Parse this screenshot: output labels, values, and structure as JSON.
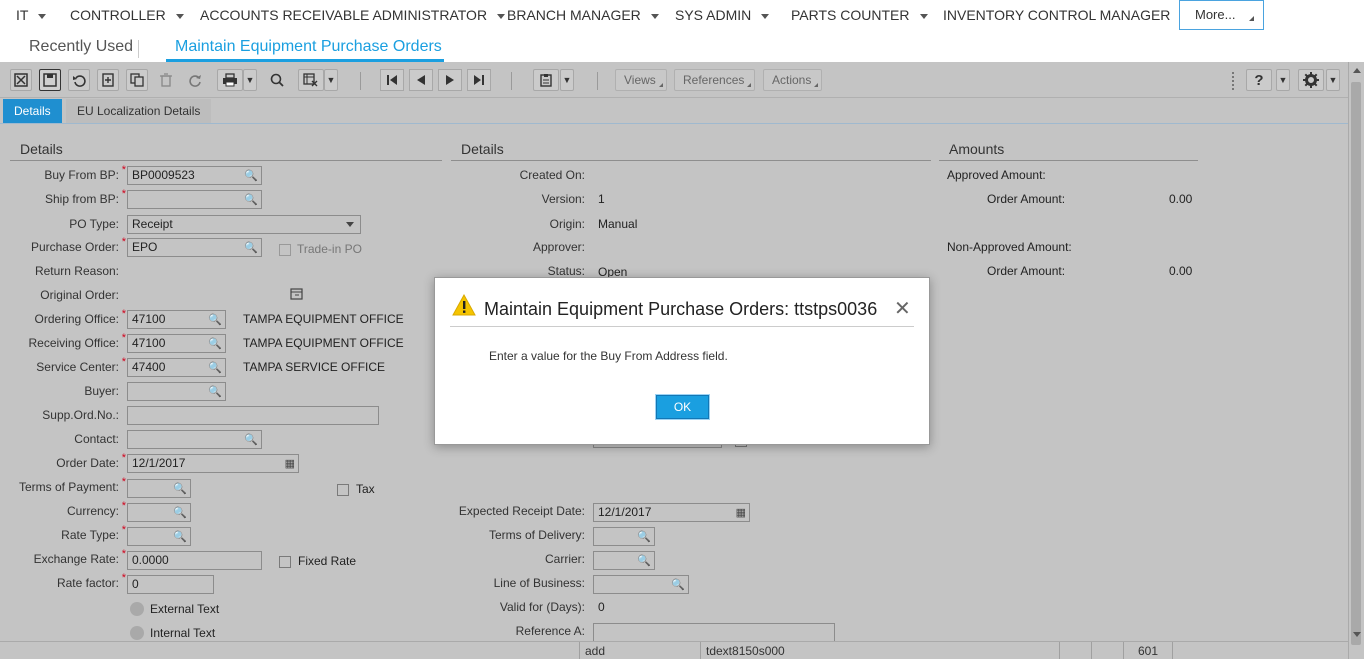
{
  "menu": {
    "items": [
      "IT",
      "CONTROLLER",
      "ACCOUNTS RECEIVABLE ADMINISTRATOR",
      "BRANCH MANAGER",
      "SYS ADMIN",
      "PARTS COUNTER",
      "INVENTORY CONTROL MANAGER"
    ],
    "more_label": "More..."
  },
  "session_tabs": {
    "recent": "Recently Used",
    "active": "Maintain Equipment Purchase Orders"
  },
  "toolbar": {
    "views": "Views",
    "references": "References",
    "actions": "Actions"
  },
  "subtabs": [
    "Details",
    "EU Localization Details"
  ],
  "left": {
    "section": "Details",
    "buy_from_bp": {
      "label": "Buy From BP:",
      "value": "BP0009523"
    },
    "ship_from_bp": {
      "label": "Ship from BP:",
      "value": ""
    },
    "po_type": {
      "label": "PO Type:",
      "value": "Receipt"
    },
    "purchase_order": {
      "label": "Purchase Order:",
      "value": "EPO"
    },
    "trade_in": "Trade-in PO",
    "return_reason": {
      "label": "Return Reason:"
    },
    "original_order": {
      "label": "Original Order:"
    },
    "ordering_office": {
      "label": "Ordering Office:",
      "value": "47100",
      "desc": "TAMPA EQUIPMENT OFFICE"
    },
    "receiving_office": {
      "label": "Receiving Office:",
      "value": "47100",
      "desc": "TAMPA EQUIPMENT OFFICE"
    },
    "service_center": {
      "label": "Service Center:",
      "value": "47400",
      "desc": "TAMPA SERVICE OFFICE"
    },
    "buyer": {
      "label": "Buyer:",
      "value": ""
    },
    "supp_ord_no": {
      "label": "Supp.Ord.No.:",
      "value": ""
    },
    "contact": {
      "label": "Contact:",
      "value": ""
    },
    "order_date": {
      "label": "Order Date:",
      "value": "12/1/2017"
    },
    "terms_of_payment": {
      "label": "Terms of Payment:",
      "value": ""
    },
    "tax": "Tax",
    "currency": {
      "label": "Currency:",
      "value": ""
    },
    "rate_type": {
      "label": "Rate Type:",
      "value": ""
    },
    "exchange_rate": {
      "label": "Exchange Rate:",
      "value": "0.0000"
    },
    "fixed_rate": "Fixed Rate",
    "rate_factor": {
      "label": "Rate factor:",
      "value": "0"
    },
    "external_text": "External Text",
    "internal_text": "Internal Text"
  },
  "middle": {
    "section": "Details",
    "created_on": {
      "label": "Created On:",
      "value": ""
    },
    "version": {
      "label": "Version:",
      "value": "1"
    },
    "origin": {
      "label": "Origin:",
      "value": "Manual"
    },
    "approver": {
      "label": "Approver:",
      "value": ""
    },
    "status": {
      "label": "Status:",
      "value": "Open"
    },
    "expected_receipt_date": {
      "label": "Expected Receipt Date:",
      "value": "12/1/2017"
    },
    "terms_of_delivery": {
      "label": "Terms of Delivery:",
      "value": ""
    },
    "carrier": {
      "label": "Carrier:",
      "value": ""
    },
    "line_of_business": {
      "label": "Line of Business:",
      "value": ""
    },
    "valid_for": {
      "label": "Valid for (Days):",
      "value": "0"
    },
    "reference_a": {
      "label": "Reference A:",
      "value": ""
    }
  },
  "right": {
    "section": "Amounts",
    "approved_amount": "Approved Amount:",
    "approved_order_amount": {
      "label": "Order Amount:",
      "value": "0.00"
    },
    "non_approved_amount": "Non-Approved Amount:",
    "non_approved_order_amount": {
      "label": "Order Amount:",
      "value": "0.00"
    }
  },
  "statusbar": {
    "mode": "add",
    "session": "tdext8150s000",
    "company": "601"
  },
  "dialog": {
    "title": "Maintain Equipment Purchase Orders: ttstps0036",
    "message": "Enter a value for the Buy From Address field.",
    "ok": "OK"
  },
  "colors": {
    "accent": "#1a9fe0",
    "overlay": "#c4c4c4",
    "warning": "#f5c400",
    "required": "#d0021b"
  }
}
